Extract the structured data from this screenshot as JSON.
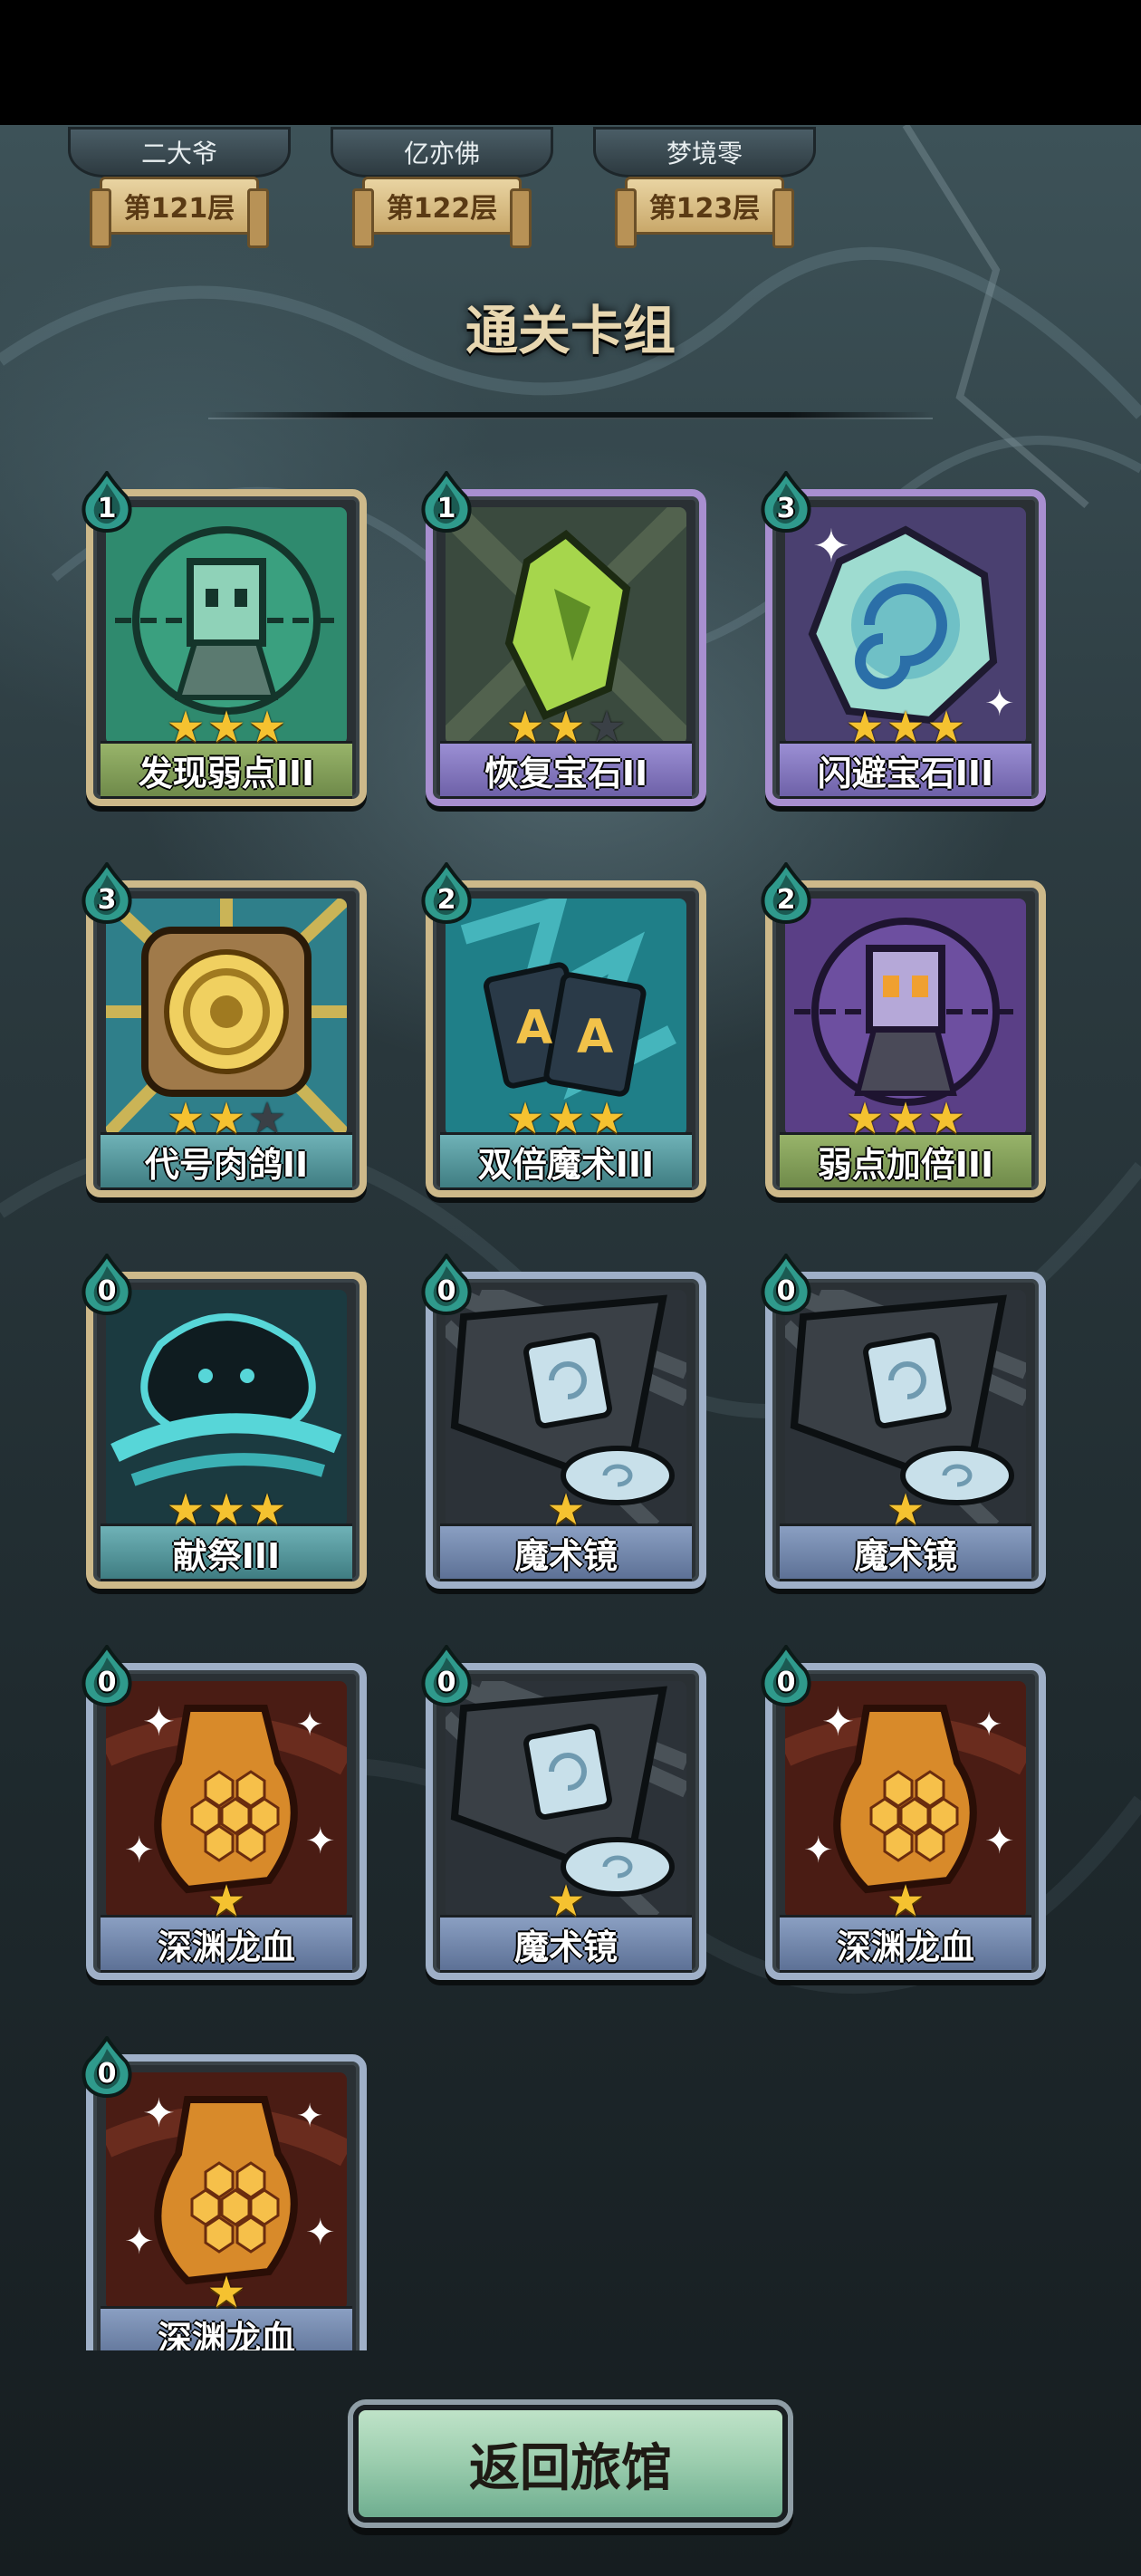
{
  "leaderboard": [
    {
      "player": "二大爷",
      "floor": "第121层"
    },
    {
      "player": "亿亦佛",
      "floor": "第122层"
    },
    {
      "player": "梦境零",
      "floor": "第123层"
    }
  ],
  "section_title": "通关卡组",
  "cards": [
    {
      "name": "发现弱点III",
      "cost": "1",
      "stars": 3,
      "rarity": "green",
      "art": "robot-target-icon"
    },
    {
      "name": "恢复宝石II",
      "cost": "1",
      "stars": 2,
      "rarity": "purple",
      "art": "green-gem-icon"
    },
    {
      "name": "闪避宝石III",
      "cost": "3",
      "stars": 3,
      "rarity": "purple",
      "art": "swirl-gem-icon"
    },
    {
      "name": "代号肉鸽II",
      "cost": "3",
      "stars": 2,
      "rarity": "teal",
      "art": "golden-disc-icon"
    },
    {
      "name": "双倍魔术III",
      "cost": "2",
      "stars": 3,
      "rarity": "teal",
      "art": "double-ace-cards-icon"
    },
    {
      "name": "弱点加倍III",
      "cost": "2",
      "stars": 3,
      "rarity": "green",
      "art": "purple-robot-icon"
    },
    {
      "name": "献祭III",
      "cost": "0",
      "stars": 3,
      "rarity": "teal",
      "art": "spirit-storm-icon"
    },
    {
      "name": "魔术镜",
      "cost": "0",
      "stars": 1,
      "rarity": "slate",
      "art": "magic-mirror-icon"
    },
    {
      "name": "魔术镜",
      "cost": "0",
      "stars": 1,
      "rarity": "slate",
      "art": "magic-mirror-icon"
    },
    {
      "name": "深渊龙血",
      "cost": "0",
      "stars": 1,
      "rarity": "slate",
      "art": "dragon-blood-icon"
    },
    {
      "name": "魔术镜",
      "cost": "0",
      "stars": 1,
      "rarity": "slate",
      "art": "magic-mirror-icon"
    },
    {
      "name": "深渊龙血",
      "cost": "0",
      "stars": 1,
      "rarity": "slate",
      "art": "dragon-blood-icon"
    },
    {
      "name": "深渊龙血",
      "cost": "0",
      "stars": 1,
      "rarity": "slate",
      "art": "dragon-blood-icon"
    }
  ],
  "return_button": "返回旅馆",
  "colors": {
    "star": "#f5c230",
    "title": "#e8d7b0",
    "button": "#9ecfb0"
  }
}
